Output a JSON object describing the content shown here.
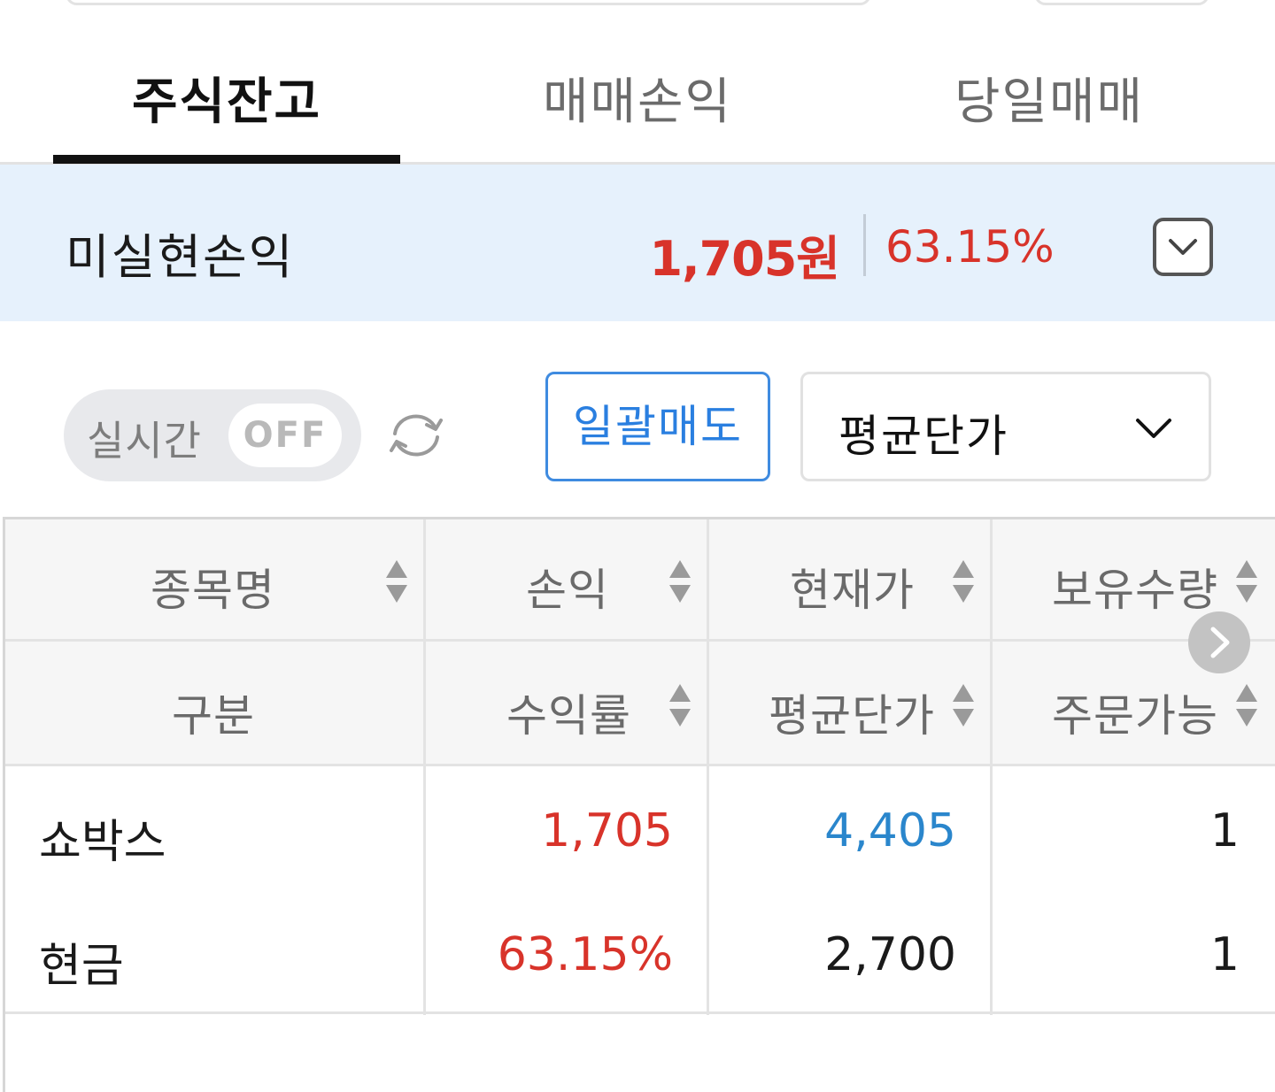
{
  "tabs": [
    {
      "label": "주식잔고",
      "active": true
    },
    {
      "label": "매매손익",
      "active": false
    },
    {
      "label": "당일매매",
      "active": false
    }
  ],
  "summary": {
    "label": "미실현손익",
    "amount": "1,705원",
    "rate": "63.15%"
  },
  "controls": {
    "realtime_label": "실시간",
    "realtime_state": "OFF",
    "bulk_sell_label": "일괄매도",
    "price_select_value": "평균단가"
  },
  "table": {
    "header_row1": [
      "종목명",
      "손익",
      "현재가",
      "보유수량"
    ],
    "header_row2": [
      "구분",
      "수익률",
      "평균단가",
      "주문가능"
    ],
    "rows": [
      {
        "name": "쇼박스",
        "pnl": "1,705",
        "current_price": "4,405",
        "holding_qty": "1"
      },
      {
        "name": "현금",
        "pnl": "63.15%",
        "current_price": "2,700",
        "holding_qty": "1"
      }
    ]
  },
  "colors": {
    "profit_red": "#d8332a",
    "price_blue": "#2a86cc",
    "accent_blue": "#3f8be0",
    "summary_bg": "#e6f1fc"
  }
}
